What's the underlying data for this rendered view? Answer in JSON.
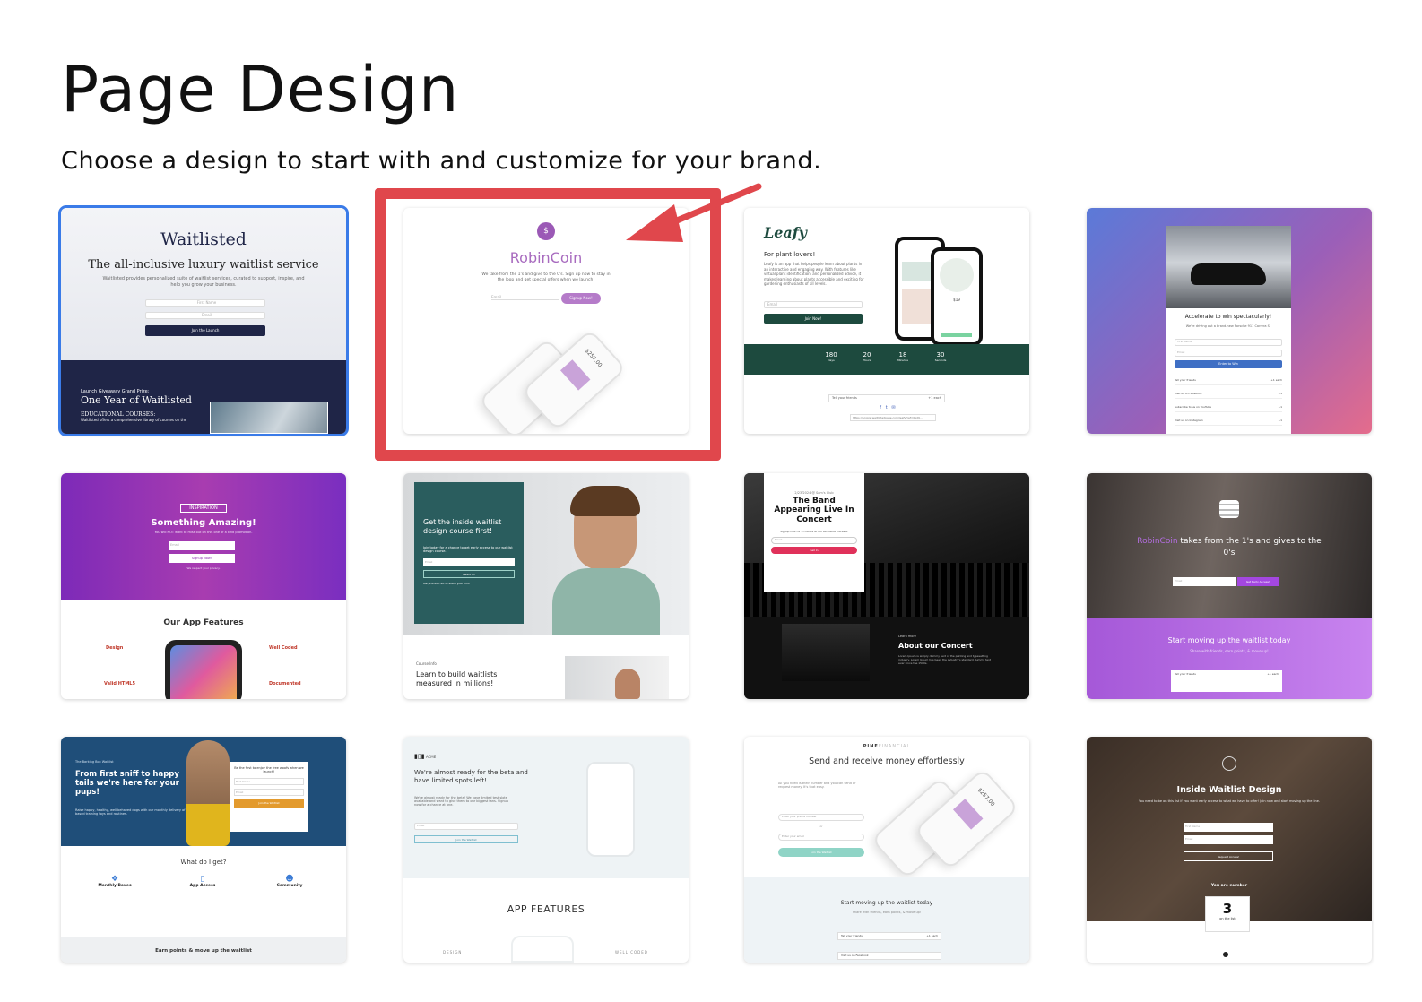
{
  "page": {
    "title": "Page Design",
    "subtitle": "Choose a design to start with and customize for your brand."
  },
  "cards": {
    "waitlisted": {
      "logo": "Waitlisted",
      "heading": "The all-inclusive luxury waitlist service",
      "body": "Waitlisted provides personalized suite of waitlist services, curated to support, inspire, and help you grow your business.",
      "field1": "First Name",
      "field2": "Email",
      "button": "Join the Launch",
      "prize_label": "Launch Giveaway Grand Prize:",
      "prize": "One Year of Waitlisted",
      "courses": "EDUCATIONAL COURSES:",
      "courses_text": "Waitlisted offers a comprehensive library of courses on the"
    },
    "robincoin": {
      "icon": "$",
      "brand": "RobinCoin",
      "body": "We take from the 1's and give to the 0's. Sign up now to stay in the loop and get special offers when we launch!",
      "field": "Email",
      "button": "Signup Now!",
      "phone_value": "$257.00"
    },
    "leafy": {
      "logo": "Leafy",
      "heading": "For plant lovers!",
      "body": "Leafy is an app that helps people learn about plants in an interactive and engaging way. With features like virtual plant identification, and personalized advice, it makes learning about plants accessible and exciting for gardening enthusiasts of all levels.",
      "field": "Email",
      "button": "Join Now!",
      "price": "$19",
      "countdown": [
        {
          "value": "180",
          "unit": "Days"
        },
        {
          "value": "20",
          "unit": "Hours"
        },
        {
          "value": "18",
          "unit": "Minutes"
        },
        {
          "value": "30",
          "unit": "Seconds"
        }
      ],
      "share_label": "Tell your friends",
      "share_points": "+1 each",
      "link": "https://ecopie.waitlistedpage.com/leafy?ref=0xd9..."
    },
    "car": {
      "heading": "Accelerate to win spectacularly!",
      "body": "We're driving out a brand-new Porsche 911 Carrera S!",
      "field1": "First Name",
      "field2": "Email",
      "button": "Enter to Win",
      "actions": [
        {
          "label": "Tell your friends",
          "points": "+1 each"
        },
        {
          "label": "Visit us on Facebook",
          "points": "+1"
        },
        {
          "label": "Subscribe to us on YouTube",
          "points": "+1"
        },
        {
          "label": "Visit us on Instagram",
          "points": "+1"
        }
      ]
    },
    "inspiration": {
      "tag": "INSPIRATION",
      "heading": "Something Amazing!",
      "body": "You will NOT want to miss out on this one of a kind promotion.",
      "field": "Email",
      "button": "Signup Now!",
      "note": "We respect your privacy.",
      "features_title": "Our App Features",
      "features": [
        "Design",
        "Well Coded",
        "Valid HTML5",
        "Documented"
      ]
    },
    "course": {
      "heading": "Get the inside waitlist design course first!",
      "body": "Join today for a chance to get early access to our waitlist design course.",
      "field": "Email",
      "button": "I want in!",
      "note": "We promise not to share your info!",
      "label": "Course Info",
      "subheading": "Learn to build waitlists measured in millions!"
    },
    "concert": {
      "date": "2/23/2024 @ Sam's Club",
      "heading": "The Band Appearing Live In Concert",
      "body": "Signup now for a chance at our exclusive pre-sale.",
      "field": "Email",
      "button": "Get In",
      "learn": "Learn more",
      "about": "About our Concert",
      "about_body": "Lorem Ipsum is simply dummy text of the printing and typesetting industry. Lorem Ipsum has been the industry's standard dummy text ever since the 1500s."
    },
    "robincoin2": {
      "brand": "RobinCoin",
      "heading_rest": "takes from the 1's and gives to the 0's",
      "field": "Email",
      "button": "Get Early Access!",
      "cta": "Start moving up the waitlist today",
      "cta_sub": "Share with friends, earn points, & move up!",
      "share": "Tell your friends",
      "share_points": "+1 each"
    },
    "dogs": {
      "tag": "The Barking Box Waitlist",
      "heading": "From first sniff to happy tails we're here for your pups!",
      "body": "Raise happy, healthy, well behaved dogs with our monthly delivery of play based training toys and routines.",
      "form_title": "Be the first to enjoy the free woofs when we launch!",
      "field1": "First Name",
      "field2": "Email",
      "button": "Join the Waitlist",
      "section": "What do I get?",
      "features": [
        {
          "title": "Monthly Boxes",
          "icon": "boxes-icon"
        },
        {
          "title": "App Access",
          "icon": "phone-icon"
        },
        {
          "title": "Community",
          "icon": "people-icon"
        }
      ],
      "footer": "Earn points & move up the waitlist"
    },
    "appfeatures": {
      "brand": "ACME",
      "heading": "We're almost ready for the beta and have limited spots left!",
      "body": "We're almost ready for the beta! We have limited test slots available and want to give them to our biggest fans. Signup now for a chance at one.",
      "field": "Email",
      "button": "Join the Waitlist",
      "section": "APP FEATURES",
      "left": "DESIGN",
      "right": "WELL CODED"
    },
    "pine": {
      "brand_a": "PINE",
      "brand_b": "FINANCIAL",
      "heading": "Send and receive money effortlessly",
      "body": "All you need is their number and you can send or request money. It's that easy.",
      "field1": "Enter your phone number",
      "or": "or",
      "field2": "Enter your email",
      "button": "Join the Waitlist",
      "phone_value": "$257.00",
      "cta": "Start moving up the waitlist today",
      "cta_sub": "Share with friends, earn points, & move up!",
      "share": "Tell your friends",
      "share_points": "+1 each",
      "share2": "Visit us on Facebook"
    },
    "inside": {
      "heading": "Inside Waitlist Design",
      "body": "You need to be on this list if you want early access to what we have to offer! Join now and start moving up the line.",
      "field1": "First Name",
      "field2": "Email",
      "button": "Request Access!",
      "position_label": "You are number",
      "position": "3",
      "position_sub": "on the list"
    }
  }
}
